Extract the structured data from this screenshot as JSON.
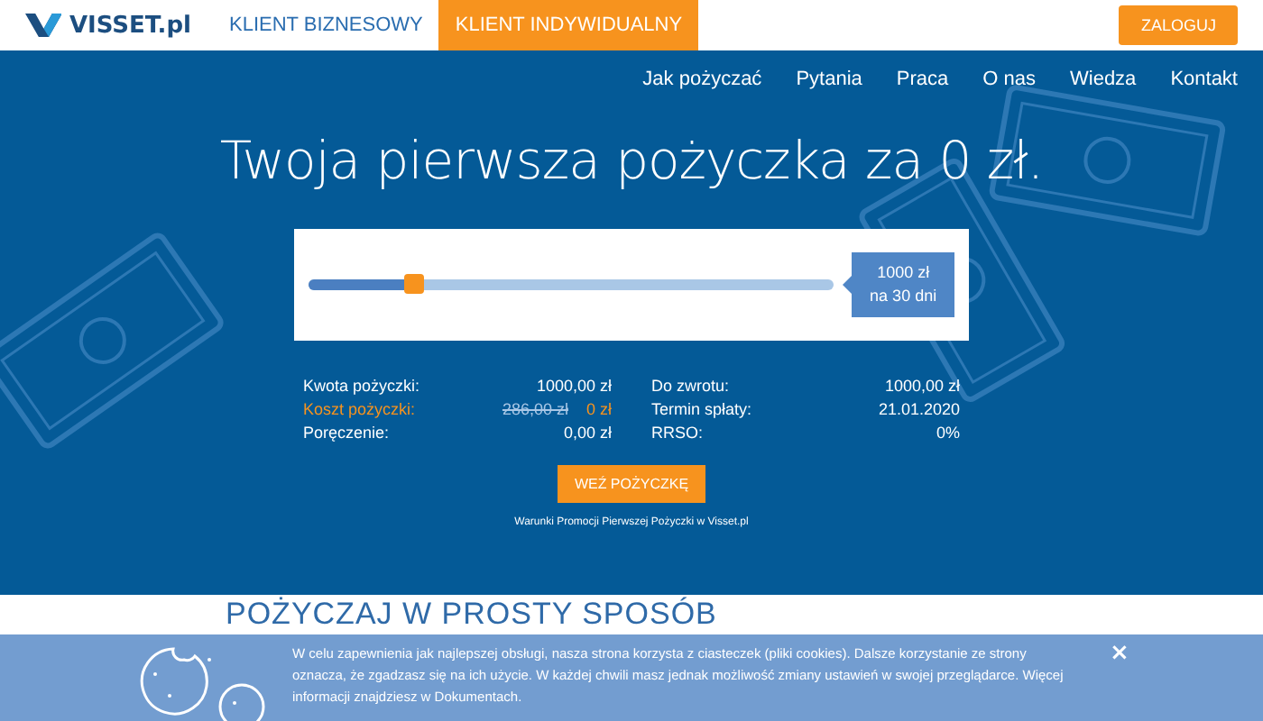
{
  "header": {
    "logo": "VISSET",
    "logo_suffix": ".pl",
    "tabs": [
      {
        "label": "KLIENT BIZNESOWY",
        "selected": false
      },
      {
        "label": "KLIENT INDYWIDUALNY",
        "selected": true
      }
    ],
    "login_button": "ZALOGUJ"
  },
  "nav": [
    "Jak pożyczać",
    "Pytania",
    "Praca",
    "O nas",
    "Wiedza",
    "Kontakt"
  ],
  "hero": {
    "title": "Twoja pierwsza pożyczka za 0 zł.",
    "slider": {
      "level": 0.2,
      "tooltip_amount": "1000 zł",
      "tooltip_period": "na 30 dni"
    },
    "details_left": [
      {
        "label": "Kwota pożyczki:",
        "value": "1000,00 zł",
        "kind": "plain"
      },
      {
        "label": "Koszt pożyczki:",
        "old_value": "286,00 zł",
        "value": "0 zł",
        "kind": "promo"
      },
      {
        "label": "Poręczenie:",
        "value": "0,00 zł",
        "kind": "plain"
      }
    ],
    "details_right": [
      {
        "label": "Do zwrotu:",
        "value": "1000,00 zł"
      },
      {
        "label": "Termin spłaty:",
        "value": "21.01.2020"
      },
      {
        "label": "RRSO:",
        "value": "0%"
      }
    ],
    "cta": "WEŹ POŻYCZKĘ",
    "terms_link": "Warunki Promocji Pierwszej Pożyczki w Visset.pl"
  },
  "section_heading": "POŻYCZAJ W PROSTY SPOSÓB",
  "cookie_banner": {
    "text_before": "W celu zapewnienia jak najlepszej obsługi, nasza strona korzysta z ciasteczek (pliki cookies). Dalsze korzystanie ze strony oznacza, że zgadzasz się na ich użycie. W każdej chwili masz jednak możliwość zmiany ustawień w swojej przeglądarce. Więcej informacji znajdziesz w ",
    "link": "Dokumentach",
    "text_after": ".",
    "close": "×"
  }
}
